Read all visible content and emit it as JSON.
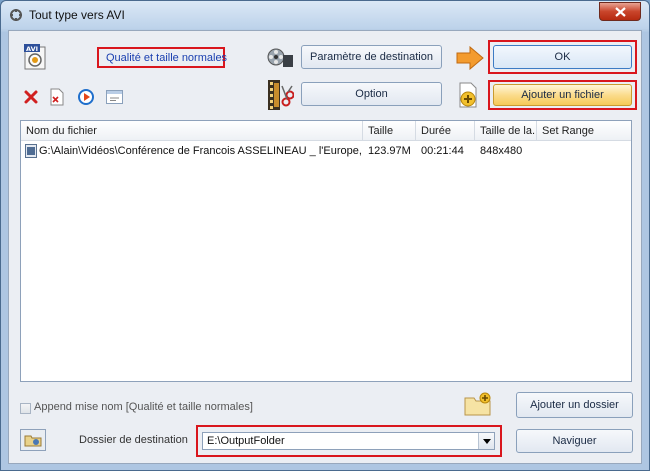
{
  "window": {
    "title": "Tout type vers AVI"
  },
  "toolbar": {
    "quality_label": "Qualité et taille normales",
    "destination_params_label": "Paramètre de destination",
    "option_label": "Option",
    "ok_label": "OK",
    "add_file_label": "Ajouter un fichier",
    "format_badge": "AVI"
  },
  "file_list": {
    "columns": [
      "Nom du fichier",
      "Taille",
      "Durée",
      "Taille de la...",
      "Set Range"
    ],
    "rows": [
      {
        "name": "G:\\Alain\\Vidéos\\Conférence de Francois ASSELINEAU _ l'Europe, c'est la...",
        "size": "123.97M",
        "duration": "00:21:44",
        "resolution": "848x480",
        "range": ""
      }
    ]
  },
  "footer": {
    "append_name_label": "Append mise nom [Qualité et taille normales]",
    "append_name_checked": false,
    "add_folder_label": "Ajouter un dossier",
    "destination_folder_label": "Dossier de destination",
    "destination_folder_value": "E:\\OutputFolder",
    "browse_label": "Naviguer"
  },
  "colors": {
    "highlight_frame": "#d9161d",
    "window_frame": "#b7cde6"
  }
}
